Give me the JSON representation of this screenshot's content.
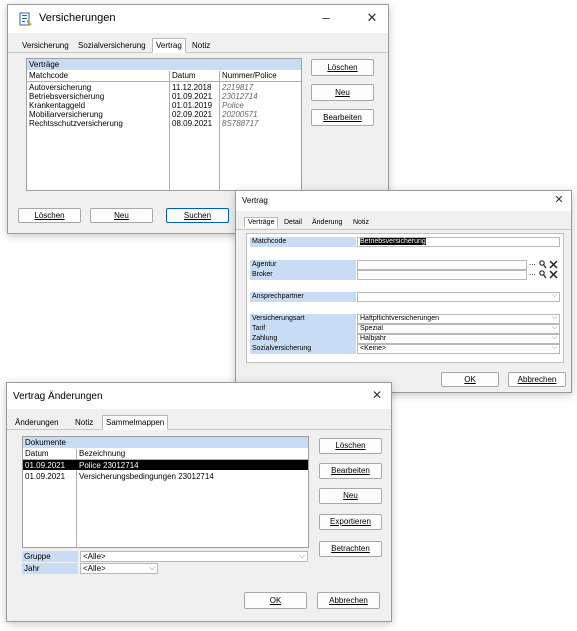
{
  "versicherungen": {
    "title": "Versicherungen",
    "tabs": [
      "Versicherung",
      "Sozialversicherung",
      "Vertrag",
      "Notiz"
    ],
    "section": "Verträge",
    "columns": [
      "Matchcode",
      "Datum",
      "Nummer/Police"
    ],
    "rows": [
      {
        "matchcode": "Autoversicherung",
        "datum": "11.12.2018",
        "nummer": "2219817"
      },
      {
        "matchcode": "Betriebsversicherung",
        "datum": "01.09.2021",
        "nummer": "23012714"
      },
      {
        "matchcode": "Krankentaggeld",
        "datum": "01.01.2019",
        "nummer": "Police"
      },
      {
        "matchcode": "Mobiliarversicherung",
        "datum": "02.09.2021",
        "nummer": "20200571"
      },
      {
        "matchcode": "Rechtsschutzversicherung",
        "datum": "08.09.2021",
        "nummer": "8S788717"
      }
    ],
    "side_buttons": [
      "Löschen",
      "Neu",
      "Bearbeiten"
    ],
    "bottom_buttons": [
      "Löschen",
      "Neu",
      "Suchen"
    ]
  },
  "vertrag": {
    "title": "Vertrag",
    "tabs": [
      "Verträge",
      "Detail",
      "Änderung",
      "Notiz"
    ],
    "matchcode_label": "Matchcode",
    "matchcode_value": "Betriebsversicherung",
    "agentur_label": "Agentur",
    "broker_label": "Broker",
    "ansprechpartner_label": "Ansprechpartner",
    "versicherungsart_label": "Versicherungsart",
    "versicherungsart_value": "Haftpflichtversicherungen",
    "tarif_label": "Tarif",
    "tarif_value": "Spezial",
    "zahlung_label": "Zahlung",
    "zahlung_value": "Halbjahr",
    "sozialversicherung_label": "Sozialversicherung",
    "sozialversicherung_value": "<Keine>",
    "ok_label": "OK",
    "cancel_label": "Abbrechen"
  },
  "aenderungen": {
    "title": "Vertrag Änderungen",
    "tabs": [
      "Änderungen",
      "Notiz",
      "Sammelmappen"
    ],
    "section": "Dokumente",
    "columns": [
      "Datum",
      "Bezeichnung"
    ],
    "rows": [
      {
        "datum": "01.09.2021",
        "bezeichnung": "Police 23012714"
      },
      {
        "datum": "01.09.2021",
        "bezeichnung": "Versicherungsbedingungen 23012714"
      }
    ],
    "side_buttons": [
      "Löschen",
      "Bearbeiten",
      "Neu",
      "Exportieren",
      "Betrachten"
    ],
    "gruppe_label": "Gruppe",
    "gruppe_value": "<Alle>",
    "jahr_label": "Jahr",
    "jahr_value": "<Alle>",
    "ok_label": "OK",
    "cancel_label": "Abbrechen"
  },
  "colors": {
    "header_blue": "#c9dcf5",
    "selection": "#000000",
    "focus_border": "#0060c0"
  },
  "icons": [
    "document-app-icon",
    "minimize-icon",
    "close-icon",
    "search-icon",
    "clear-icon",
    "chevron-down-icon"
  ]
}
